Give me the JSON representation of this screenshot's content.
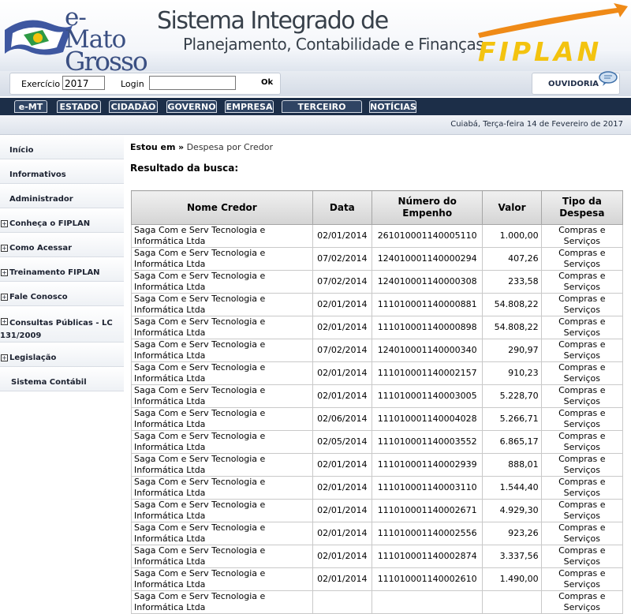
{
  "header": {
    "logo_line1": "e-Mato",
    "logo_line2": "Grosso",
    "title_line1": "Sistema Integrado de",
    "title_line2": "Planejamento, Contabilidade e Finanças",
    "brand": "FIPLAN",
    "colors": {
      "brand_yellow": "#f3c30f",
      "brand_orange": "#ef8a17",
      "nav_bg": "#1c2e48"
    }
  },
  "login": {
    "exercicio_label": "Exercício",
    "exercicio_value": "2017",
    "login_label": "Login",
    "login_value": "",
    "ok_label": "Ok",
    "ouvidoria_label": "OUVIDORIA"
  },
  "nav": {
    "tabs": [
      "e-MT",
      "ESTADO",
      "CIDADÃO",
      "GOVERNO",
      "EMPRESA",
      "TERCEIRO SETOR",
      "NOTÍCIAS"
    ]
  },
  "date_text": "Cuiabá, Terça-feira 14 de Fevereiro de 2017",
  "sidebar": {
    "items": [
      {
        "label": "Início",
        "expandable": false
      },
      {
        "label": "Informativos",
        "expandable": false
      },
      {
        "label": "Administrador",
        "expandable": false
      },
      {
        "label": "Conheça o FIPLAN",
        "expandable": true
      },
      {
        "label": "Como Acessar",
        "expandable": true
      },
      {
        "label": "Treinamento FIPLAN",
        "expandable": true
      },
      {
        "label": "Fale Conosco",
        "expandable": true
      },
      {
        "label": "Consultas Públicas - LC 131/2009",
        "expandable": true
      },
      {
        "label": "Legislação",
        "expandable": true
      },
      {
        "label": "Sistema Contábil",
        "expandable": false
      }
    ]
  },
  "main": {
    "breadcrumb_label": "Estou em",
    "breadcrumb_sep": "»",
    "breadcrumb_page": "Despesa por Credor",
    "result_title": "Resultado da busca:",
    "columns": [
      "Nome Credor",
      "Data",
      "Número do Empenho",
      "Valor",
      "Tipo da Despesa"
    ],
    "rows": [
      [
        "Saga Com e Serv Tecnologia e Informática Ltda",
        "02/01/2014",
        "261010001140005110",
        "1.000,00",
        "Compras e Serviços"
      ],
      [
        "Saga Com e Serv Tecnologia e Informática Ltda",
        "07/02/2014",
        "124010001140000294",
        "407,26",
        "Compras e Serviços"
      ],
      [
        "Saga Com e Serv Tecnologia e Informática Ltda",
        "07/02/2014",
        "124010001140000308",
        "233,58",
        "Compras e Serviços"
      ],
      [
        "Saga Com e Serv Tecnologia e Informática Ltda",
        "02/01/2014",
        "111010001140000881",
        "54.808,22",
        "Compras e Serviços"
      ],
      [
        "Saga Com e Serv Tecnologia e Informática Ltda",
        "02/01/2014",
        "111010001140000898",
        "54.808,22",
        "Compras e Serviços"
      ],
      [
        "Saga Com e Serv Tecnologia e Informática Ltda",
        "07/02/2014",
        "124010001140000340",
        "290,97",
        "Compras e Serviços"
      ],
      [
        "Saga Com e Serv Tecnologia e Informática Ltda",
        "02/01/2014",
        "111010001140002157",
        "910,23",
        "Compras e Serviços"
      ],
      [
        "Saga Com e Serv Tecnologia e Informática Ltda",
        "02/01/2014",
        "111010001140003005",
        "5.228,70",
        "Compras e Serviços"
      ],
      [
        "Saga Com e Serv Tecnologia e Informática Ltda",
        "02/06/2014",
        "111010001140004028",
        "5.266,71",
        "Compras e Serviços"
      ],
      [
        "Saga Com e Serv Tecnologia e Informática Ltda",
        "02/05/2014",
        "111010001140003552",
        "6.865,17",
        "Compras e Serviços"
      ],
      [
        "Saga Com e Serv Tecnologia e Informática Ltda",
        "02/01/2014",
        "111010001140002939",
        "888,01",
        "Compras e Serviços"
      ],
      [
        "Saga Com e Serv Tecnologia e Informática Ltda",
        "02/01/2014",
        "111010001140003110",
        "1.544,40",
        "Compras e Serviços"
      ],
      [
        "Saga Com e Serv Tecnologia e Informática Ltda",
        "02/01/2014",
        "111010001140002671",
        "4.929,30",
        "Compras e Serviços"
      ],
      [
        "Saga Com e Serv Tecnologia e Informática Ltda",
        "02/01/2014",
        "111010001140002556",
        "923,26",
        "Compras e Serviços"
      ],
      [
        "Saga Com e Serv Tecnologia e Informática Ltda",
        "02/01/2014",
        "111010001140002874",
        "3.337,56",
        "Compras e Serviços"
      ],
      [
        "Saga Com e Serv Tecnologia e Informática Ltda",
        "02/01/2014",
        "111010001140002610",
        "1.490,00",
        "Compras e Serviços"
      ],
      [
        "Saga Com e Serv Tecnologia e Informática Ltda",
        "",
        "",
        "",
        "Compras e Serviços"
      ]
    ]
  }
}
